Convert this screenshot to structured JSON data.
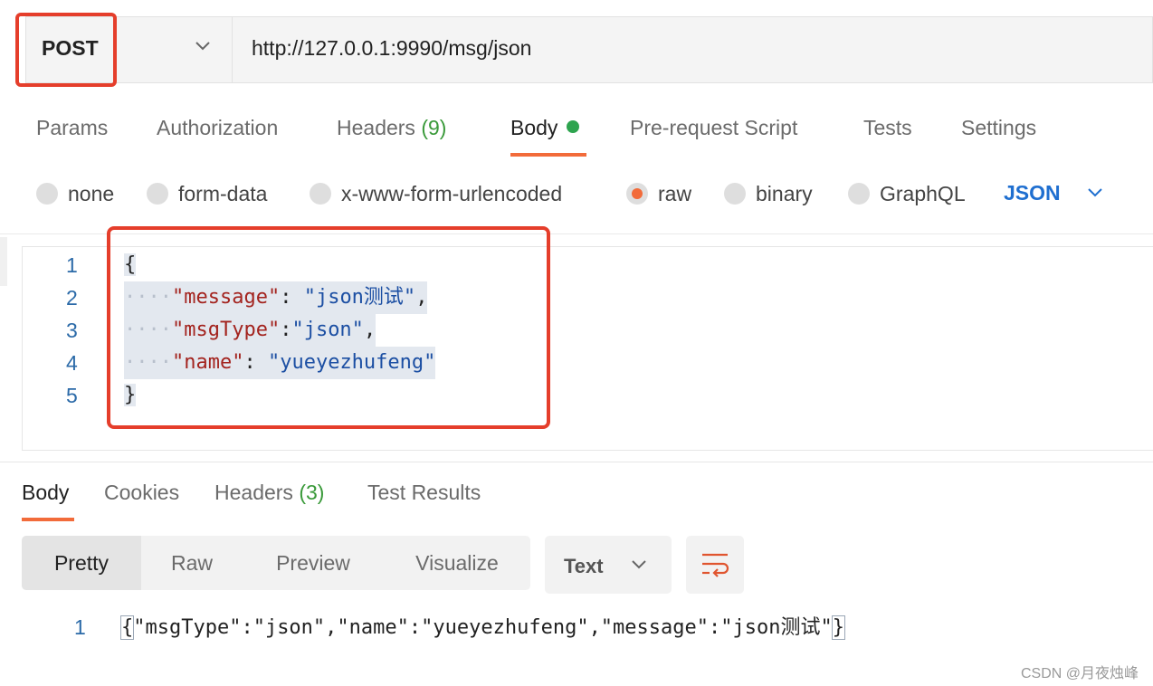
{
  "request": {
    "method": "POST",
    "url": "http://127.0.0.1:9990/msg/json"
  },
  "request_tabs": {
    "params": "Params",
    "authorization": "Authorization",
    "headers": "Headers",
    "headers_count": "(9)",
    "body": "Body",
    "pre_request": "Pre-request Script",
    "tests": "Tests",
    "settings": "Settings"
  },
  "body_types": {
    "none": "none",
    "form_data": "form-data",
    "urlencoded": "x-www-form-urlencoded",
    "raw": "raw",
    "binary": "binary",
    "graphql": "GraphQL",
    "selected": "raw",
    "language": "JSON"
  },
  "editor": {
    "lines": [
      {
        "no": "1",
        "brace": "{"
      },
      {
        "no": "2",
        "key": "\"message\"",
        "sep": ": ",
        "value": "\"json测试\"",
        "tail": ","
      },
      {
        "no": "3",
        "key": "\"msgType\"",
        "sep": ":",
        "value": "\"json\"",
        "tail": ","
      },
      {
        "no": "4",
        "key": "\"name\"",
        "sep": ": ",
        "value": "\"yueyezhufeng\"",
        "tail": ""
      },
      {
        "no": "5",
        "brace": "}"
      }
    ],
    "indent": "····"
  },
  "response_tabs": {
    "body": "Body",
    "cookies": "Cookies",
    "headers": "Headers",
    "headers_count": "(3)",
    "test_results": "Test Results"
  },
  "response_view": {
    "pretty": "Pretty",
    "raw": "Raw",
    "preview": "Preview",
    "visualize": "Visualize",
    "format": "Text"
  },
  "response_body": {
    "line_no": "1",
    "open": "{",
    "content": "\"msgType\":\"json\",\"name\":\"yueyezhufeng\",\"message\":\"json测试\"",
    "close": "}"
  },
  "watermark": "CSDN @月夜烛峰",
  "colors": {
    "accent": "#f26b3a",
    "highlight_box": "#e53e2b",
    "json_link": "#1f6fd0",
    "status_green": "#2ea44f"
  }
}
